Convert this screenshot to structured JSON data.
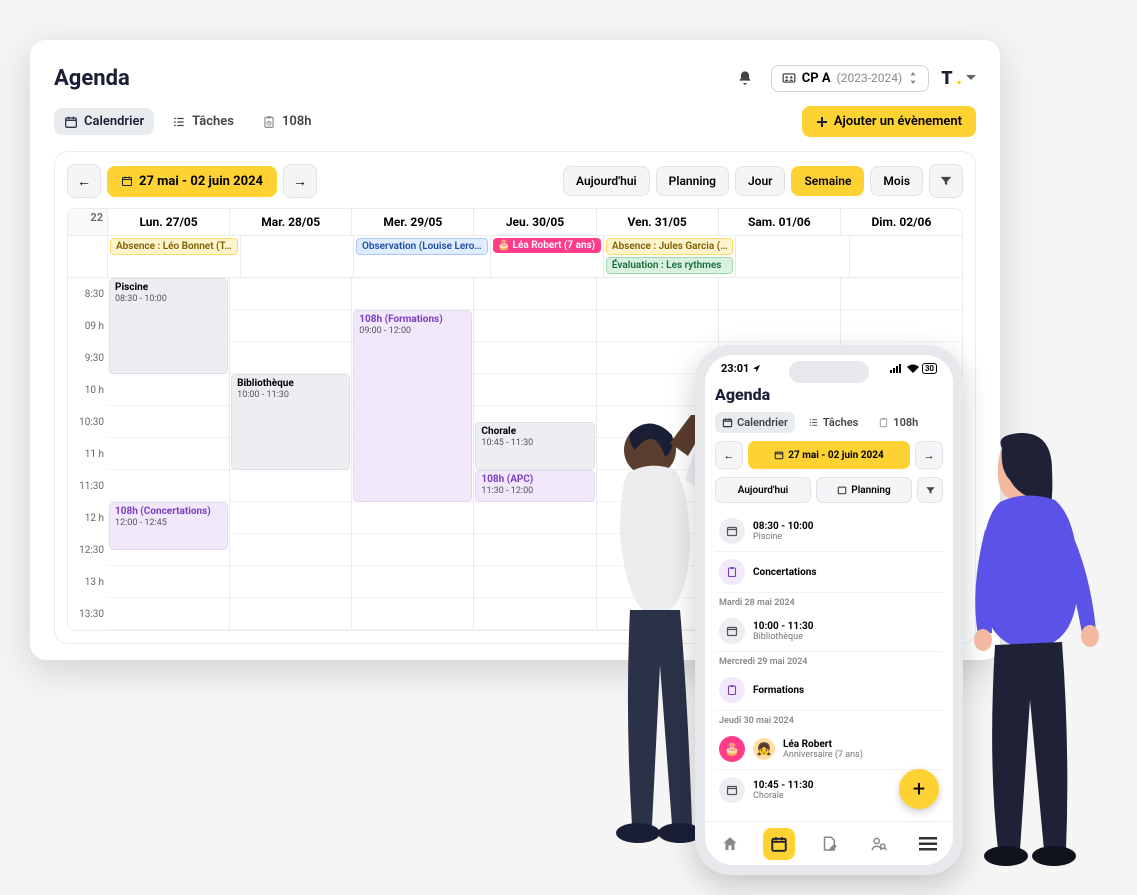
{
  "header": {
    "title": "Agenda",
    "class_label": "CP A",
    "class_year": "(2023-2024)"
  },
  "tabs": {
    "calendar": "Calendrier",
    "tasks": "Tâches",
    "hours": "108h"
  },
  "buttons": {
    "add_event": "Ajouter un évènement"
  },
  "toolbar": {
    "date_range": "27 mai - 02 juin 2024",
    "today": "Aujourd'hui",
    "planning": "Planning",
    "day": "Jour",
    "week": "Semaine",
    "month": "Mois"
  },
  "week_number": "22",
  "days": {
    "d0": "Lun. 27/05",
    "d1": "Mar. 28/05",
    "d2": "Mer. 29/05",
    "d3": "Jeu. 30/05",
    "d4": "Ven. 31/05",
    "d5": "Sam. 01/06",
    "d6": "Dim. 02/06"
  },
  "allday": {
    "absence_leo": "Absence : Léo Bonnet (T…",
    "observation": "Observation (Louise Lero…",
    "birthday": "🎂 Léa Robert (7 ans)",
    "absence_jules": "Absence : Jules Garcia (…",
    "evaluation": "Évaluation : Les rythmes"
  },
  "time_labels": [
    "8:30",
    "09 h",
    "9:30",
    "10 h",
    "10:30",
    "11 h",
    "11:30",
    "12 h",
    "12:30",
    "13 h",
    "13:30"
  ],
  "events": {
    "piscine": {
      "title": "Piscine",
      "time": "08:30 - 10:00"
    },
    "concertations": {
      "title": "108h (Concertations)",
      "time": "12:00 - 12:45"
    },
    "bibliotheque": {
      "title": "Bibliothèque",
      "time": "10:00 - 11:30"
    },
    "formations": {
      "title": "108h (Formations)",
      "time": "09:00 - 12:00"
    },
    "chorale": {
      "title": "Chorale",
      "time": "10:45 - 11:30"
    },
    "apc": {
      "title": "108h (APC)",
      "time": "11:30 - 12:00"
    }
  },
  "mobile": {
    "status_time": "23:01",
    "battery": "30",
    "title": "Agenda",
    "tabs": {
      "calendar": "Calendrier",
      "tasks": "Tâches",
      "hours": "108h"
    },
    "date_range": "27 mai - 02 juin 2024",
    "today": "Aujourd'hui",
    "planning": "Planning",
    "items": {
      "piscine_time": "08:30 - 10:00",
      "piscine": "Piscine",
      "concertations": "Concertations",
      "day_tue": "Mardi 28 mai 2024",
      "biblio_time": "10:00 - 11:30",
      "biblio": "Bibliothèque",
      "day_wed": "Mercredi 29 mai 2024",
      "formations": "Formations",
      "day_thu": "Jeudi 30 mai 2024",
      "lea_name": "Léa Robert",
      "lea_sub": "Anniversaire (7 ans)",
      "chorale_time": "10:45 - 11:30",
      "chorale": "Chorale"
    }
  }
}
